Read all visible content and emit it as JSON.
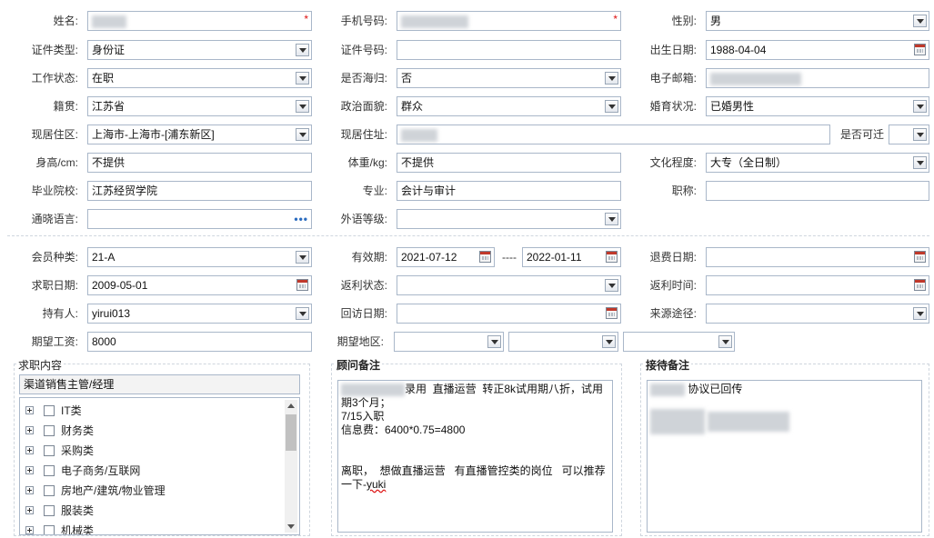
{
  "section1": {
    "name_label": "姓名:",
    "phone_label": "手机号码:",
    "gender_label": "性别:",
    "gender_value": "男",
    "idtype_label": "证件类型:",
    "idtype_value": "身份证",
    "idno_label": "证件号码:",
    "birth_label": "出生日期:",
    "birth_value": "1988-04-04",
    "workstatus_label": "工作状态:",
    "workstatus_value": "在职",
    "returnee_label": "是否海归:",
    "returnee_value": "否",
    "email_label": "电子邮箱:",
    "native_label": "籍贯:",
    "native_value": "江苏省",
    "political_label": "政治面貌:",
    "political_value": "群众",
    "marital_label": "婚育状况:",
    "marital_value": "已婚男性",
    "district_label": "现居住区:",
    "district_value": "上海市-上海市-[浦东新区]",
    "address_label": "现居住址:",
    "relocate_label": "是否可迁",
    "height_label": "身高/cm:",
    "height_value": "不提供",
    "weight_label": "体重/kg:",
    "weight_value": "不提供",
    "education_label": "文化程度:",
    "education_value": "大专（全日制）",
    "school_label": "毕业院校:",
    "school_value": "江苏经贸学院",
    "major_label": "专业:",
    "major_value": "会计与审计",
    "title_label": "职称:",
    "language_label": "通晓语言:",
    "foreign_label": "外语等级:"
  },
  "section2": {
    "member_label": "会员种类:",
    "member_value": "21-A",
    "valid_label": "有效期:",
    "valid_from": "2021-07-12",
    "valid_sep": "----",
    "valid_to": "2022-01-11",
    "refund_date_label": "退费日期:",
    "jobdate_label": "求职日期:",
    "jobdate_value": "2009-05-01",
    "rebate_status_label": "返利状态:",
    "rebate_time_label": "返利时间:",
    "holder_label": "持有人:",
    "holder_value": "yirui013",
    "visit_label": "回访日期:",
    "source_label": "来源途径:",
    "salary_label": "期望工资:",
    "salary_value": "8000",
    "region_label": "期望地区:"
  },
  "job_panel": {
    "title": "求职内容",
    "selected": "渠道销售主管/经理",
    "tree": [
      "IT类",
      "财务类",
      "采购类",
      "电子商务/互联网",
      "房地产/建筑/物业管理",
      "服装类",
      "机械类"
    ]
  },
  "advisor_panel": {
    "title": "顾问备注",
    "line1": "录用  直播运营  转正8k试用期八折，试用",
    "line2": "期3个月；",
    "line3": "7/15入职",
    "line4": "信息费：6400*0.75=4800",
    "line5": "离职，  想做直播运营   有直播管控类的岗位   可以推荐",
    "line6_prefix": "一下-",
    "line6_word": "yuki"
  },
  "reception_panel": {
    "title": "接待备注",
    "line1": "协议已回传"
  },
  "colors": {
    "required": "#dd1111",
    "border": "#a9b7c9",
    "accent": "#2a6bbf"
  }
}
